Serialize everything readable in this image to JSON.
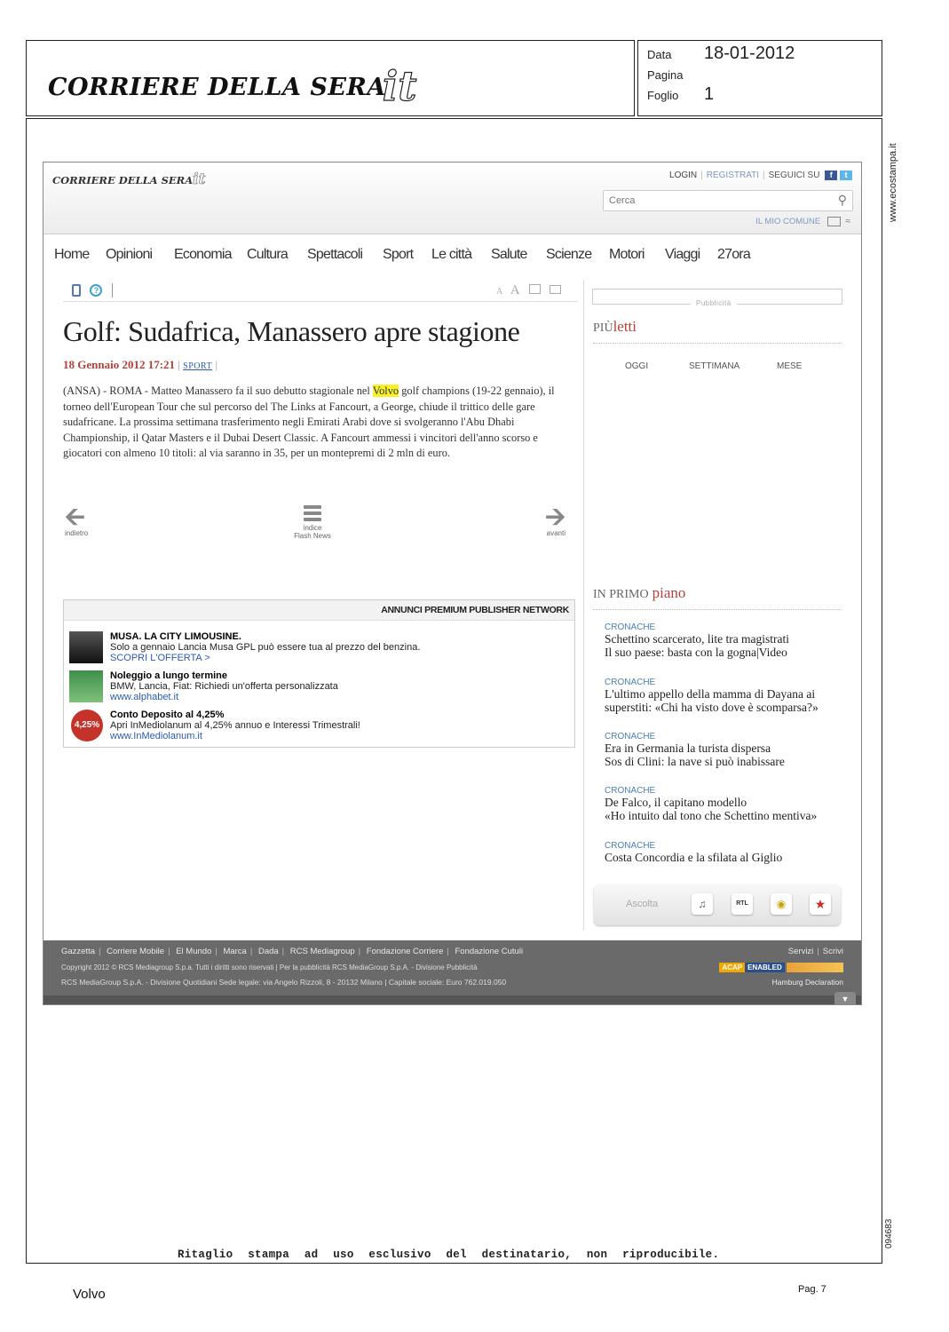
{
  "masthead": {
    "logo_text": "CORRIERE DELLA SERA",
    "logo_badge": "it",
    "data_label": "Data",
    "data_value": "18-01-2012",
    "pagina_label": "Pagina",
    "pagina_value": "",
    "foglio_label": "Foglio",
    "foglio_value": "1"
  },
  "side_text": {
    "site": "www.ecostampa.it",
    "code": "094683"
  },
  "site_header": {
    "logo_text": "CORRIERE DELLA SERA",
    "logo_badge": "it",
    "login": "LOGIN",
    "register": "REGISTRATI",
    "follow": "SEGUICI SU",
    "search_placeholder": "Cerca",
    "my_comune": "IL MIO COMUNE"
  },
  "nav": [
    "Home",
    "Opinioni",
    "Economia",
    "Cultura",
    "Spettacoli",
    "Sport",
    "Le città",
    "Salute",
    "Scienze",
    "Motori",
    "Viaggi",
    "27ora"
  ],
  "article": {
    "title": "Golf: Sudafrica, Manassero apre stagione",
    "date": "18 Gennaio 2012 17:21",
    "section": "SPORT",
    "body_before": "(ANSA) - ROMA - Matteo Manassero fa il suo debutto stagionale nel ",
    "highlight": "Volvo",
    "body_after": " golf champions (19-22 gennaio), il torneo dell'European Tour che sul percorso del The Links at Fancourt, a George, chiude il trittico delle gare sudafricane. La prossima settimana trasferimento negli Emirati Arabi dove si svolgeranno l'Abu Dhabi Championship, il Qatar Masters e il Dubai Desert Classic. A Fancourt ammessi i vincitori dell'anno scorso e giocatori con almeno 10 titoli: al via saranno in 35, per un montepremi di 2 mln di euro.",
    "prev_label": "indietro",
    "index_label_1": "indice",
    "index_label_2": "Flash News",
    "next_label": "avanti"
  },
  "ads": {
    "header": "ANNUNCI PREMIUM PUBLISHER NETWORK",
    "items": [
      {
        "title": "MUSA. LA CITY LIMOUSINE.",
        "text": "Solo a gennaio Lancia Musa GPL può essere tua al prezzo del benzina.",
        "link": "SCOPRI L'OFFERTA >"
      },
      {
        "title": "Noleggio a lungo termine",
        "text": "BMW, Lancia, Fiat: Richiedi un'offerta personalizzata",
        "link": "www.alphabet.it"
      },
      {
        "title": "Conto Deposito al 4,25%",
        "text": "Apri InMediolanum al 4,25% annuo e Interessi Trimestrali!",
        "link": "www.InMediolanum.it",
        "badge": "4,25%"
      }
    ]
  },
  "sidebar": {
    "ad_label": "Pubblicità",
    "piu_label_1": "PIÙ",
    "piu_label_2": "letti",
    "tabs": [
      "OGGI",
      "SETTIMANA",
      "MESE"
    ],
    "primo_label_1": "IN PRIMO",
    "primo_label_2": "piano",
    "items": [
      {
        "cat": "CRONACHE",
        "line1": "Schettino scarcerato, lite tra magistrati",
        "line2": "Il suo paese: basta con la gogna|Video"
      },
      {
        "cat": "CRONACHE",
        "line1": "L'ultimo appello della mamma di Dayana ai",
        "line2": "superstiti: «Chi ha visto dove è scomparsa?»"
      },
      {
        "cat": "CRONACHE",
        "line1": "Era in Germania la turista dispersa",
        "line2": "Sos di Clini: la nave si può inabissare"
      },
      {
        "cat": "CRONACHE",
        "line1": "De Falco, il capitano modello",
        "line2": "«Ho intuito dal tono che Schettino mentiva»"
      },
      {
        "cat": "CRONACHE",
        "line1": "Costa Concordia e la sfilata al Giglio",
        "line2": ""
      }
    ],
    "listen_label": "Ascolta"
  },
  "footer": {
    "links": [
      "Gazzetta",
      "Corriere Mobile",
      "El Mundo",
      "Marca",
      "Dada",
      "RCS Mediagroup",
      "Fondazione Corriere",
      "Fondazione Cutuli"
    ],
    "right_links": [
      "Servizi",
      "Scrivi"
    ],
    "copyright": "Copyright 2012 © RCS Mediagroup S.p.a. Tutti i diritti sono riservati | Per la pubblicità RCS MediaGroup S.p.A. - Divisione Pubblicità",
    "legal": "RCS MediaGroup S.p.A. - Divisione Quotidiani Sede legale: via Angelo Rizzoli, 8 - 20132 Milano | Capitale sociale: Euro 762.019.050",
    "badge_acap": "ACAP",
    "badge_enabled": "ENABLED",
    "hamburg": "Hamburg Declaration"
  },
  "disclaimer": "Ritaglio stampa ad uso esclusivo del destinatario, non riproducibile.",
  "bottom": {
    "keyword": "Volvo",
    "page": "Pag. 7"
  }
}
